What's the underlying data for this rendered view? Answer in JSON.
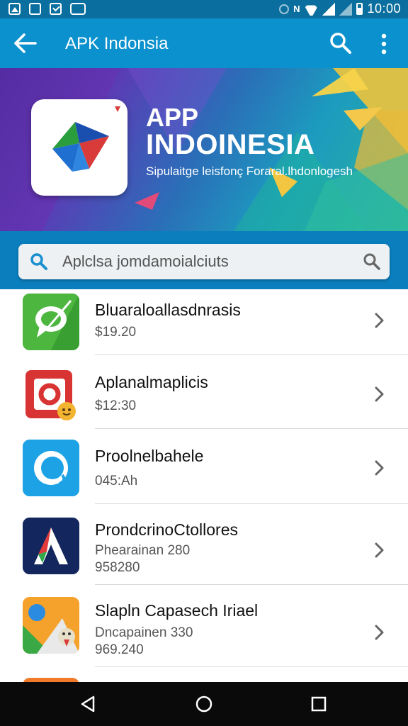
{
  "status_bar": {
    "time": "10:00",
    "nfc_label": "N",
    "colors": {
      "background": "#0a6f9e"
    }
  },
  "app_bar": {
    "title": "APK Indonsia",
    "icons": [
      "back-arrow-icon",
      "search-icon",
      "more-vert-icon"
    ],
    "color": "#0b91cd"
  },
  "banner": {
    "title_line1": "APP",
    "title_line2": "INDOINESIA",
    "subtitle": "Sipulaitge leisfonç Foraral.lhdonlogesh"
  },
  "search": {
    "placeholder": "Aplclsa jomdamoialciuts"
  },
  "apps": [
    {
      "name": "Bluaraloallasdnrasis",
      "meta1": "$19.20",
      "meta2": ""
    },
    {
      "name": "Aplanalmaplicis",
      "meta1": "$12:30",
      "meta2": ""
    },
    {
      "name": "Proolnelbahele",
      "meta1": "045:Ah",
      "meta2": ""
    },
    {
      "name": "ProndcrinoCtollores",
      "meta1": "Phearainan 280",
      "meta2": "958280"
    },
    {
      "name": "Slapln Capasech Iriael",
      "meta1": "Dncapainen 330",
      "meta2": "969.240"
    }
  ],
  "nav_bar": {
    "icons": [
      "nav-back-icon",
      "nav-home-icon",
      "nav-recents-icon"
    ]
  }
}
